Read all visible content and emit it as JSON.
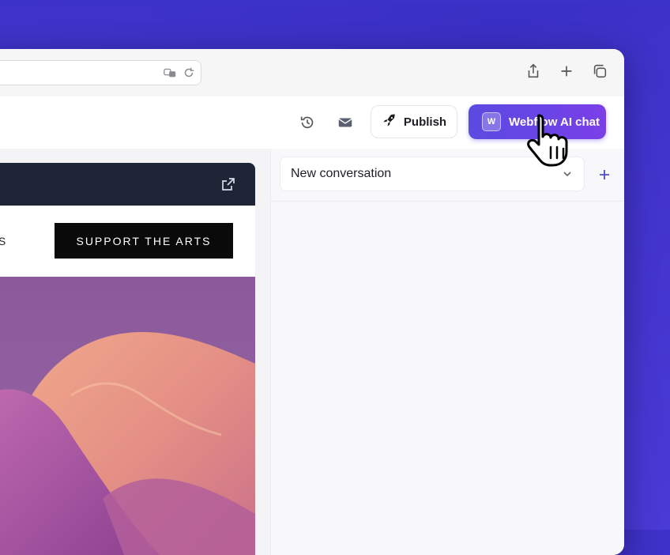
{
  "editor_toolbar": {
    "publish_label": "Publish",
    "ai_chat_label": "Webflow AI chat",
    "ai_badge": "W"
  },
  "preview": {
    "nav_partial_text": "IS",
    "support_label": "SUPPORT THE ARTS"
  },
  "chat": {
    "conversation_value": "New conversation"
  },
  "colors": {
    "background": "#3f33c9",
    "ai_button": "#5b4be0",
    "preview_header": "#1e2536",
    "support_button": "#0a0a0a"
  },
  "icons": {
    "history": "history-icon",
    "mail": "mail-icon",
    "publish": "rocket-icon",
    "share": "share-icon",
    "new_tab": "plus-icon",
    "tabs": "tabs-icon",
    "external": "external-link-icon"
  }
}
